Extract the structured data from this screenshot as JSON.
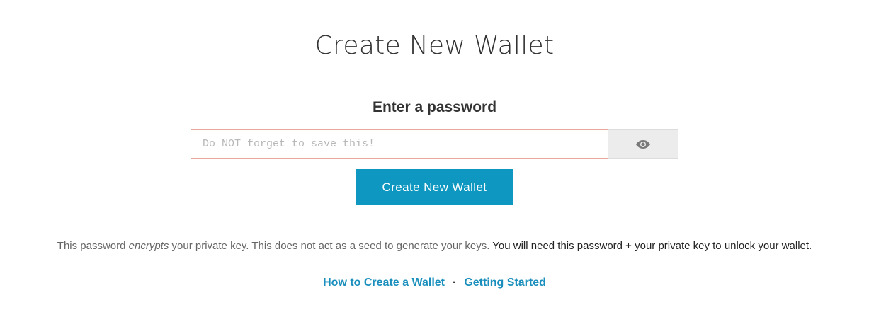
{
  "page": {
    "title": "Create New Wallet"
  },
  "password_section": {
    "heading": "Enter a password",
    "input_placeholder": "Do NOT forget to save this!",
    "input_value": "",
    "toggle_icon": "eye-icon"
  },
  "actions": {
    "create_button_label": "Create New Wallet"
  },
  "info": {
    "part1": "This password ",
    "emphasis": "encrypts",
    "part2": " your private key. This does not act as a seed to generate your keys. ",
    "strong_part": "You will need this password + your private key to unlock your wallet."
  },
  "links": {
    "how_to_create": "How to Create a Wallet",
    "separator": "·",
    "getting_started": "Getting Started"
  },
  "colors": {
    "accent": "#0e97c0",
    "link": "#1a8fbd",
    "input_border": "#e8a99c",
    "toggle_bg": "#ececec"
  }
}
